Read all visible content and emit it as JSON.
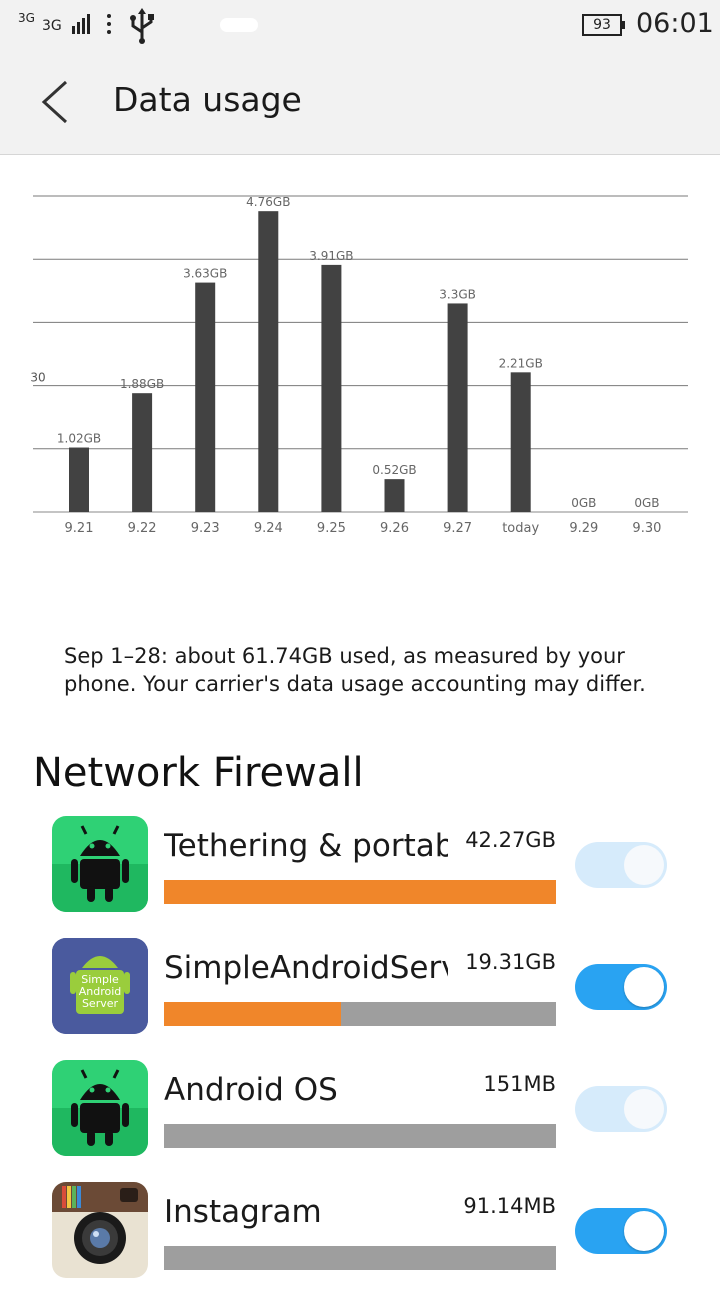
{
  "status_bar": {
    "network_top": "3G",
    "network_type": "3G",
    "battery": "93",
    "time": "06:01"
  },
  "header": {
    "title": "Data usage"
  },
  "chart_data": {
    "type": "bar",
    "categories": [
      "9.21",
      "9.22",
      "9.23",
      "9.24",
      "9.25",
      "9.26",
      "9.27",
      "today",
      "9.29",
      "9.30"
    ],
    "values": [
      1.02,
      1.88,
      3.63,
      4.76,
      3.91,
      0.52,
      3.3,
      2.21,
      0,
      0
    ],
    "value_labels": [
      "1.02GB",
      "1.88GB",
      "3.63GB",
      "4.76GB",
      "3.91GB",
      "0.52GB",
      "3.3GB",
      "2.21GB",
      "0GB",
      "0GB"
    ],
    "left_label": "30",
    "ylim": [
      0,
      5
    ],
    "grid": true,
    "color": "#424242"
  },
  "summary": "Sep 1–28: about 61.74GB used, as measured by your phone. Your carrier's data usage accounting may differ.",
  "section_title": "Network Firewall",
  "apps": [
    {
      "name": "Tethering & portable hotspot",
      "size": "42.27GB",
      "usage_fraction": 1.0,
      "toggle": "dim",
      "icon": "android-icon"
    },
    {
      "name": "SimpleAndroidServer",
      "size": "19.31GB",
      "usage_fraction": 0.45,
      "toggle": "on",
      "icon": "simple-android-server-icon",
      "icon_text": [
        "Simple",
        "Android",
        "Server"
      ]
    },
    {
      "name": "Android OS",
      "size": "151MB",
      "usage_fraction": 0.0,
      "toggle": "dim",
      "icon": "android-icon"
    },
    {
      "name": "Instagram",
      "size": "91.14MB",
      "usage_fraction": 0.0,
      "toggle": "on",
      "icon": "instagram-icon"
    }
  ],
  "colors": {
    "accent": "#29a3f2",
    "usage_bar": "#f0862a",
    "bar_track": "#9e9e9e"
  }
}
